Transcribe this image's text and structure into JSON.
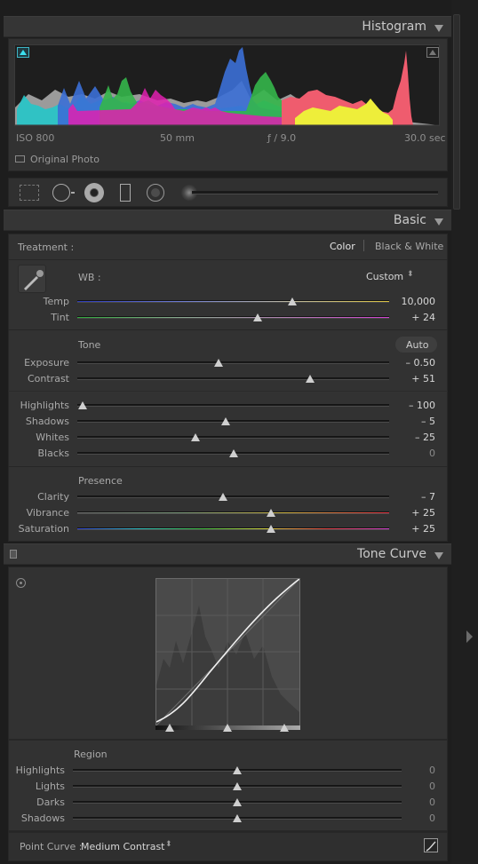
{
  "histogram": {
    "title": "Histogram",
    "iso": "ISO 800",
    "focal": "50 mm",
    "aperture": "ƒ / 9.0",
    "shutter": "30.0 sec",
    "original_photo_label": "Original Photo"
  },
  "tools": {
    "icons": [
      "crop-overlay-icon",
      "spot-removal-icon",
      "red-eye-icon",
      "graduated-filter-icon",
      "radial-filter-icon",
      "adjustment-brush-icon"
    ]
  },
  "basic": {
    "title": "Basic",
    "treatment_label": "Treatment :",
    "color_label": "Color",
    "bw_label": "Black & White",
    "wb_label": "WB :",
    "wb_value": "Custom",
    "temp": {
      "label": "Temp",
      "value": "10,000",
      "pos": 0.69
    },
    "tint": {
      "label": "Tint",
      "value": "+ 24",
      "pos": 0.58
    },
    "tone_label": "Tone",
    "auto_label": "Auto",
    "exposure": {
      "label": "Exposure",
      "value": "– 0.50",
      "pos": 0.45
    },
    "contrast": {
      "label": "Contrast",
      "value": "+ 51",
      "pos": 0.75
    },
    "highlights": {
      "label": "Highlights",
      "value": "– 100",
      "pos": 0.0
    },
    "shadows": {
      "label": "Shadows",
      "value": "– 5",
      "pos": 0.475
    },
    "whites": {
      "label": "Whites",
      "value": "– 25",
      "pos": 0.375
    },
    "blacks": {
      "label": "Blacks",
      "value": "0",
      "pos": 0.5
    },
    "presence_label": "Presence",
    "clarity": {
      "label": "Clarity",
      "value": "– 7",
      "pos": 0.465
    },
    "vibrance": {
      "label": "Vibrance",
      "value": "+ 25",
      "pos": 0.625
    },
    "saturation": {
      "label": "Saturation",
      "value": "+ 25",
      "pos": 0.625
    }
  },
  "tone_curve": {
    "title": "Tone Curve",
    "region_label": "Region",
    "highlights": {
      "label": "Highlights",
      "value": "0",
      "pos": 0.5
    },
    "lights": {
      "label": "Lights",
      "value": "0",
      "pos": 0.5
    },
    "darks": {
      "label": "Darks",
      "value": "0",
      "pos": 0.5
    },
    "shadows": {
      "label": "Shadows",
      "value": "0",
      "pos": 0.5
    },
    "point_curve_label": "Point Curve :",
    "point_curve_value": "Medium Contrast"
  },
  "colors": {
    "panel": "#323232",
    "header": "#353535",
    "value_text": "#d7d7d7",
    "label_text": "#a9a9a9"
  }
}
